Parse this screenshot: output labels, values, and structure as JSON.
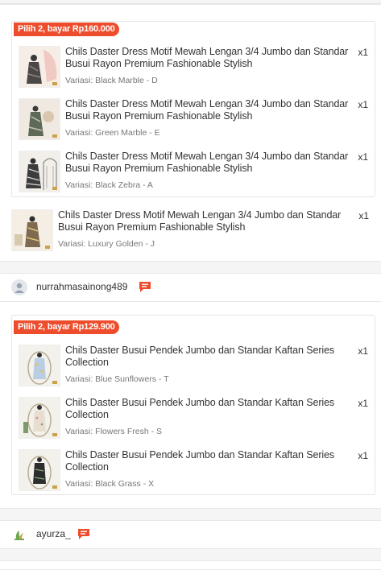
{
  "orders": [
    {
      "bundle_label": "Pilih 2, bayar Rp160.000",
      "bundle_items": [
        {
          "title": "Chils Daster Dress Motif Mewah Lengan 3/4 Jumbo dan Standar Busui Rayon Premium Fashionable Stylish",
          "variant": "Variasi: Black Marble - D",
          "qty": "x1"
        },
        {
          "title": "Chils Daster Dress Motif Mewah Lengan 3/4 Jumbo dan Standar Busui Rayon Premium Fashionable Stylish",
          "variant": "Variasi: Green Marble - E",
          "qty": "x1"
        },
        {
          "title": "Chils Daster Dress Motif Mewah Lengan 3/4 Jumbo dan Standar Busui Rayon Premium Fashionable Stylish",
          "variant": "Variasi: Black Zebra - A",
          "qty": "x1"
        }
      ],
      "extra_item": {
        "title": "Chils Daster Dress Motif Mewah Lengan 3/4 Jumbo dan Standar Busui Rayon Premium Fashionable Stylish",
        "variant": "Variasi: Luxury Golden - J",
        "qty": "x1"
      }
    },
    {
      "seller": "nurrahmasainong489",
      "bundle_label": "Pilih 2, bayar Rp129.900",
      "bundle_items": [
        {
          "title": "Chils Daster Busui Pendek Jumbo dan Standar Kaftan Series Collection",
          "variant": "Variasi: Blue Sunflowers - T",
          "qty": "x1"
        },
        {
          "title": "Chils Daster Busui Pendek Jumbo dan Standar Kaftan Series Collection",
          "variant": "Variasi: Flowers Fresh - S",
          "qty": "x1"
        },
        {
          "title": "Chils Daster Busui Pendek Jumbo dan Standar Kaftan Series Collection",
          "variant": "Variasi: Black Grass - X",
          "qty": "x1"
        }
      ]
    },
    {
      "seller": "ayurza_"
    }
  ],
  "colors": {
    "accent": "#ee4d2d",
    "text": "#333333",
    "muted": "#777777"
  }
}
